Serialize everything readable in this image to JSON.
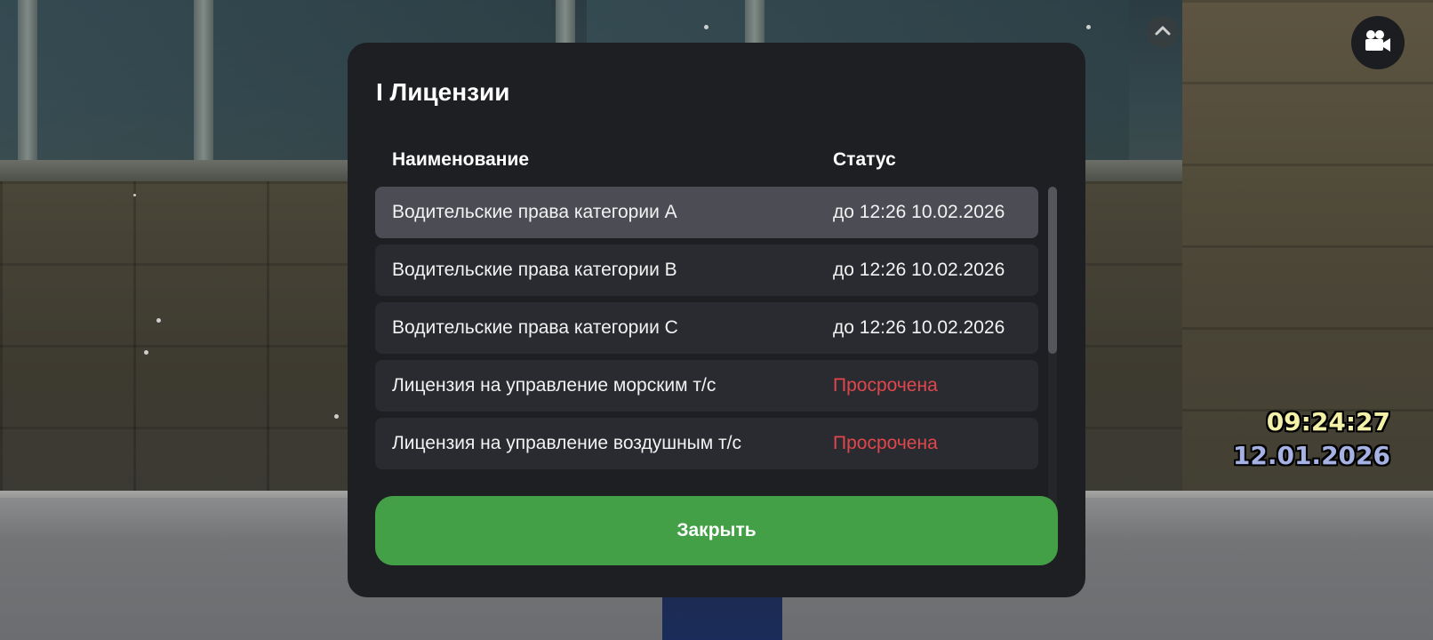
{
  "hud": {
    "chevron_icon": "chevron-up-icon",
    "camera_icon": "video-camera-icon",
    "time": "09:24:27",
    "date": "12.01.2026",
    "time_color": "#f3f0a8",
    "date_color": "#a6b2e3"
  },
  "modal": {
    "title": "I Лицензии",
    "columns": {
      "name": "Наименование",
      "status": "Статус"
    },
    "rows": [
      {
        "name": "Водительские права категории A",
        "status": "до 12:26 10.02.2026",
        "expired": false,
        "selected": true
      },
      {
        "name": "Водительские права категории B",
        "status": "до 12:26 10.02.2026",
        "expired": false,
        "selected": false
      },
      {
        "name": "Водительские права категории C",
        "status": "до 12:26 10.02.2026",
        "expired": false,
        "selected": false
      },
      {
        "name": "Лицензия на управление морским т/с",
        "status": "Просрочена",
        "expired": true,
        "selected": false
      },
      {
        "name": "Лицензия на управление воздушным т/с",
        "status": "Просрочена",
        "expired": true,
        "selected": false
      }
    ],
    "close_label": "Закрыть",
    "colors": {
      "panel": "#1e1f23",
      "row": "#2a2b30",
      "row_selected": "#4b4c54",
      "expired_text": "#e0474c",
      "close_button": "#43a047"
    }
  }
}
